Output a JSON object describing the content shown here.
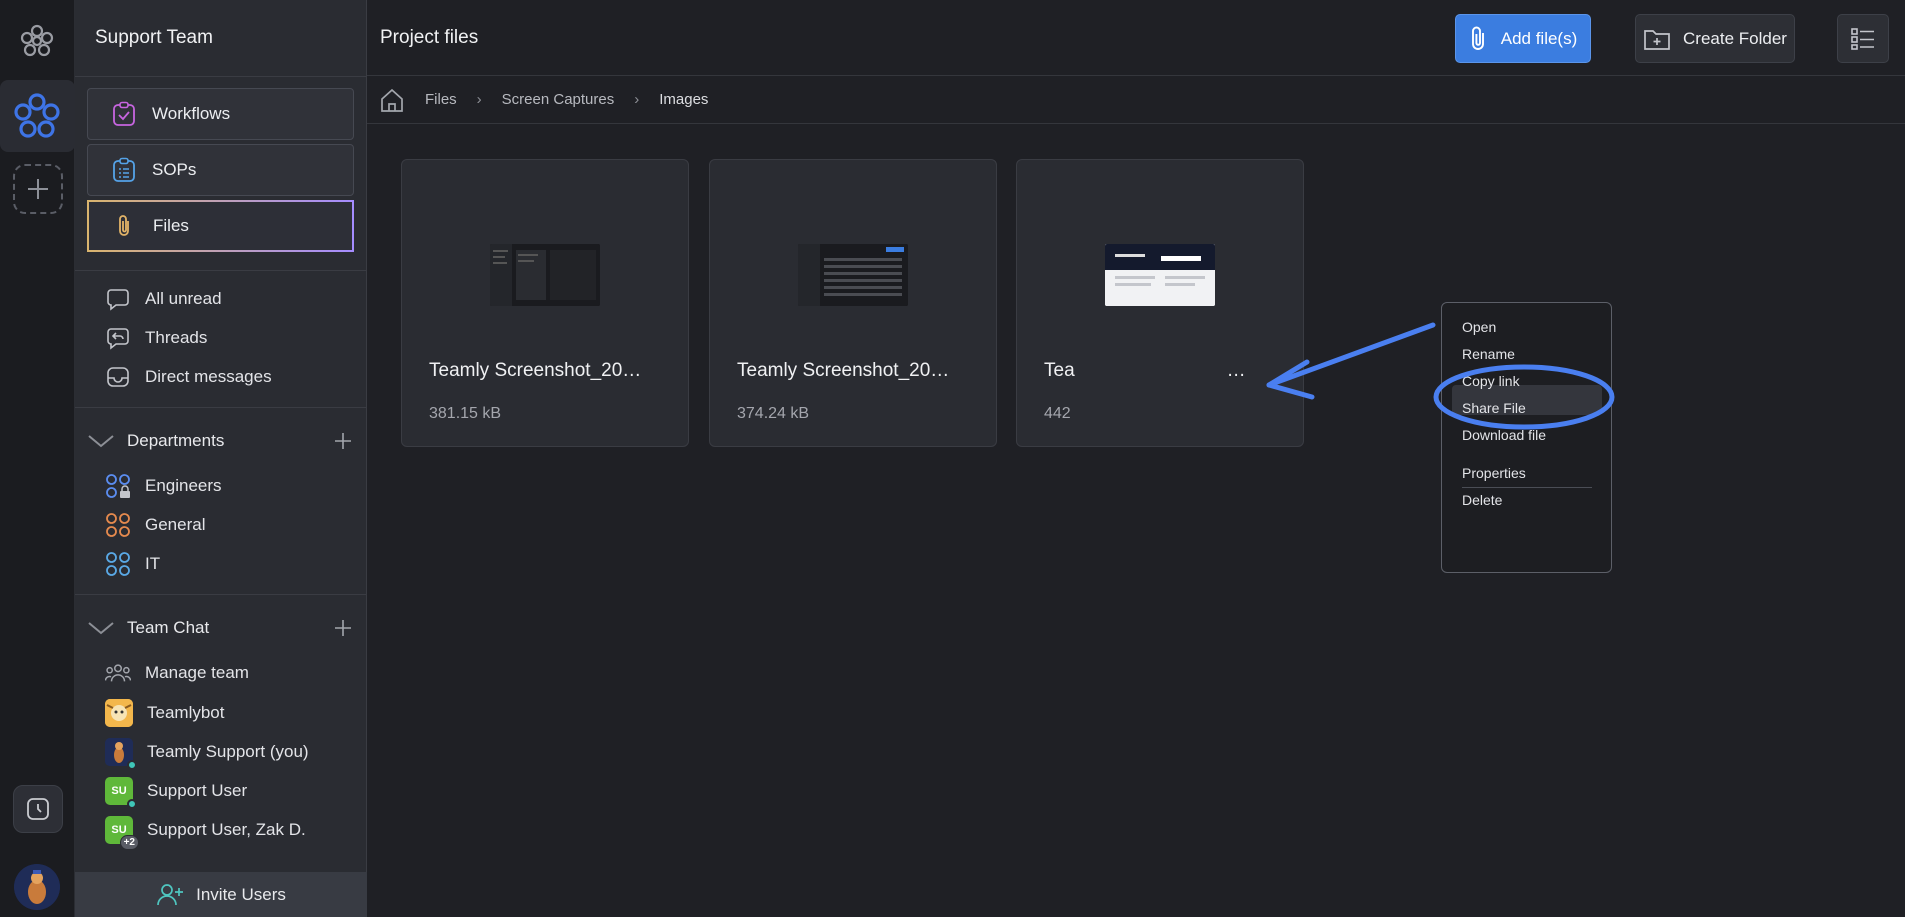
{
  "sidebar": {
    "title": "Support Team",
    "nav": [
      {
        "label": "Workflows",
        "icon": "workflow-icon"
      },
      {
        "label": "SOPs",
        "icon": "clipboard-list-icon"
      },
      {
        "label": "Files",
        "icon": "paperclip-icon"
      }
    ],
    "items": [
      {
        "label": "All unread",
        "icon": "chat-bubble-icon"
      },
      {
        "label": "Threads",
        "icon": "threads-icon"
      },
      {
        "label": "Direct messages",
        "icon": "inbox-icon"
      }
    ],
    "departments": {
      "label": "Departments",
      "channels": [
        {
          "label": "Engineers",
          "color": "#5b8df0"
        },
        {
          "label": "General",
          "color": "#e58a4e"
        },
        {
          "label": "IT",
          "color": "#5aa9e6"
        }
      ]
    },
    "team_chat": {
      "label": "Team Chat",
      "members": [
        {
          "label": "Manage team"
        },
        {
          "label": "Teamlybot"
        },
        {
          "label": "Teamly Support (you)"
        },
        {
          "label": "Support User",
          "initials": "SU"
        },
        {
          "label": "Support User, Zak D.",
          "initials": "SU",
          "extra": "+2"
        }
      ]
    },
    "invite_label": "Invite Users"
  },
  "main": {
    "title": "Project files",
    "add_files_label": "Add file(s)",
    "create_folder_label": "Create Folder",
    "breadcrumb": [
      "Files",
      "Screen Captures",
      "Images"
    ],
    "files": [
      {
        "name": "Teamly Screenshot_20…",
        "size": "381.15 kB"
      },
      {
        "name": "Teamly Screenshot_20…",
        "size": "374.24 kB"
      },
      {
        "name": "Tea",
        "name_tail": "…",
        "size": "442"
      }
    ]
  },
  "context_menu": {
    "items": [
      "Open",
      "Rename",
      "Copy link",
      "Share File",
      "Download file"
    ],
    "items2": [
      "Properties",
      "Delete"
    ],
    "highlighted": "Copy link"
  },
  "colors": {
    "accent": "#3b7de0",
    "annotation": "#4a7ff0"
  }
}
